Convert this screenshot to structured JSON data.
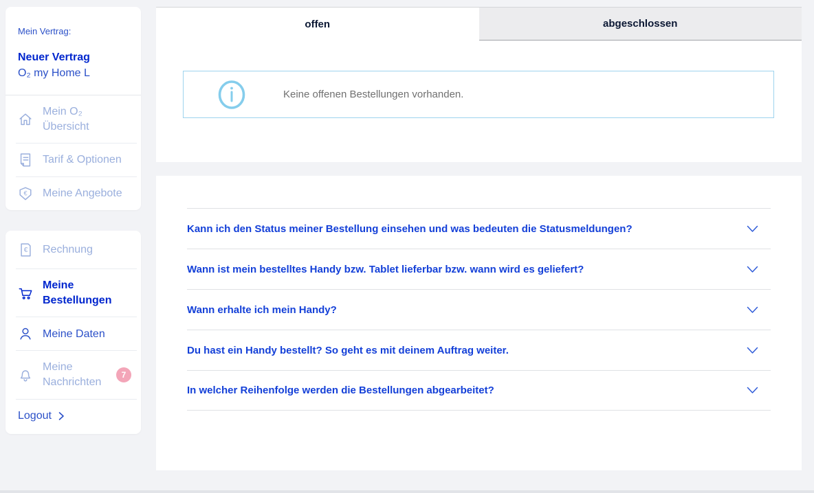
{
  "colors": {
    "accent_blue": "#0026ce",
    "link_blue": "#2b50c8",
    "muted_blue": "#9aafdd",
    "tab_navy": "#0b1733",
    "info_border": "#9ed3ee",
    "info_icon": "#85cdec",
    "body_text_gray": "#707070",
    "badge_pink": "#f3a5b8",
    "faq_blue": "#1440d8"
  },
  "sidebar": {
    "contract_label": "Mein Vertrag:",
    "contract_name": "Neuer Vertrag",
    "contract_plan": "O₂ my Home L",
    "nav_primary": [
      {
        "label": "Mein O₂ Übersicht",
        "icon": "home-icon"
      },
      {
        "label": "Tarif & Optionen",
        "icon": "tariff-document-icon"
      },
      {
        "label": "Meine Angebote",
        "icon": "offer-tag-icon"
      }
    ],
    "nav_secondary": [
      {
        "label": "Rechnung",
        "icon": "invoice-icon"
      },
      {
        "label": "Meine Bestellungen",
        "icon": "cart-icon"
      },
      {
        "label": "Meine Daten",
        "icon": "user-icon"
      },
      {
        "label": "Meine Nachrichten",
        "icon": "bell-icon",
        "badge": "7"
      }
    ],
    "logout_label": "Logout"
  },
  "main": {
    "tabs": [
      {
        "label": "offen"
      },
      {
        "label": "abgeschlossen"
      }
    ],
    "info_message": "Keine offenen Bestellungen vorhanden.",
    "faq": [
      {
        "question": "Kann ich den Status meiner Bestellung einsehen und was bedeuten die Statusmeldungen?"
      },
      {
        "question": "Wann ist mein bestelltes Handy bzw. Tablet lieferbar bzw. wann wird es geliefert?"
      },
      {
        "question": "Wann erhalte ich mein Handy?"
      },
      {
        "question": "Du hast ein Handy bestellt? So geht es mit deinem Auftrag weiter."
      },
      {
        "question": "In welcher Reihenfolge werden die Bestellungen abgearbeitet?"
      }
    ]
  }
}
